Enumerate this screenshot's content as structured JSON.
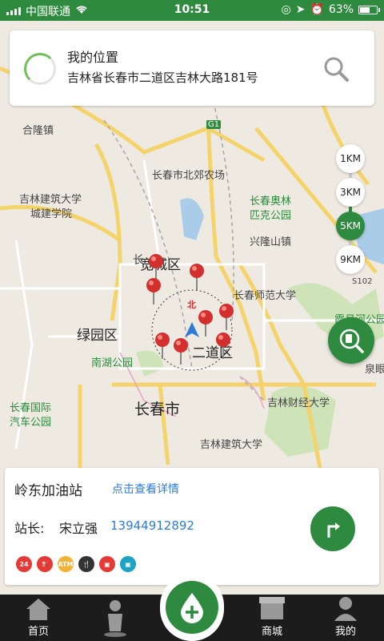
{
  "status": {
    "carrier": "中国联通",
    "time": "10:51",
    "battery": "63%",
    "battery_level": 0.63
  },
  "location": {
    "title": "我的位置",
    "address": "吉林省长春市二道区吉林大路181号"
  },
  "zoom_levels": [
    {
      "label": "1KM"
    },
    {
      "label": "3KM"
    },
    {
      "label": "5KM",
      "active": true
    },
    {
      "label": "9KM"
    }
  ],
  "map_labels": {
    "hefei": "合隆镇",
    "beijiao": "长春市北郊农场",
    "jianzhu1": "吉林建筑大学",
    "jianzhu1b": "城建学院",
    "aolin": "长春奥林",
    "aolinb": "匹克公园",
    "xinglong": "兴隆山镇",
    "kuancheng": "宽城区",
    "shifan": "长春师范大学",
    "s102": "S102",
    "lvyuan": "绿园区",
    "erdao": "二道区",
    "nanhu": "南湖公园",
    "guoji": "长春国际",
    "guojib": "汽车公园",
    "changchun": "长春市",
    "caijing": "吉林财经大学",
    "jianzhu2": "吉林建筑大学",
    "jingyue": "霞月河公园",
    "quanyan": "泉眼",
    "g1": "G1",
    "north": "北",
    "changlabel": "长"
  },
  "station": {
    "name": "岭东加油站",
    "detail_link": "点击查看详情",
    "manager_label": "站长:",
    "manager_name": "宋立强",
    "phone": "13944912892"
  },
  "service_icons": [
    {
      "name": "24h-icon",
      "text": "24",
      "color": "#e53935"
    },
    {
      "name": "fuel-icon",
      "text": "⛽",
      "color": "#e53935"
    },
    {
      "name": "atm-icon",
      "text": "ATM",
      "color": "#f2b233"
    },
    {
      "name": "food-icon",
      "text": "🍴",
      "color": "#333333"
    },
    {
      "name": "shop-icon",
      "text": "▣",
      "color": "#e53935"
    },
    {
      "name": "wash-icon",
      "text": "▣",
      "color": "#1ba3c4"
    }
  ],
  "tabs": [
    {
      "label": "首页",
      "icon": "home-icon"
    },
    {
      "label": "",
      "icon": "person-icon"
    },
    {
      "label": "",
      "icon": "add-fuel-icon"
    },
    {
      "label": "商城",
      "icon": "store-icon"
    },
    {
      "label": "我的",
      "icon": "profile-icon"
    }
  ],
  "colors": {
    "primary": "#2d8a3e",
    "link": "#2d7bd6",
    "pin": "#d32f2f"
  }
}
